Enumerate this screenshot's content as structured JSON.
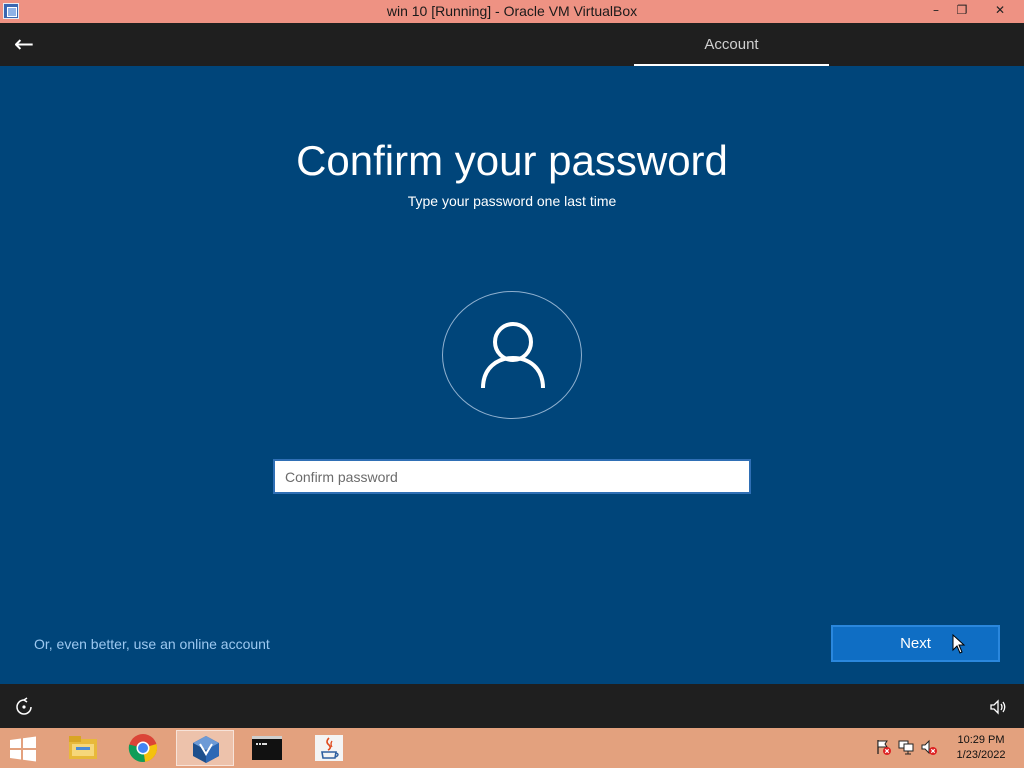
{
  "window": {
    "title": "win 10 [Running] - Oracle VM VirtualBox",
    "icon": "virtualbox-window-icon",
    "controls": [
      "minimize-icon",
      "restore-icon",
      "close-icon"
    ]
  },
  "oobe": {
    "back_icon": "back-arrow-icon",
    "nav_tab": "Account",
    "heading": "Confirm your password",
    "subheading": "Type your password one last time",
    "avatar_icon": "user-icon",
    "password_field": {
      "placeholder": "Confirm password",
      "value": ""
    },
    "online_account_link": "Or, even better, use an online account",
    "next_button": "Next",
    "bottom_left_icon": "ease-of-access-icon",
    "bottom_right_icon": "volume-icon"
  },
  "taskbar": {
    "start_icon": "windows-start-icon",
    "pinned": [
      {
        "name": "file-explorer-icon",
        "active": false
      },
      {
        "name": "chrome-icon",
        "active": false
      },
      {
        "name": "virtualbox-icon",
        "active": true
      },
      {
        "name": "command-prompt-icon",
        "active": false
      },
      {
        "name": "java-icon",
        "active": false
      }
    ],
    "tray_icons": [
      "action-center-flag-icon",
      "network-icon",
      "volume-muted-icon"
    ],
    "clock": {
      "time": "10:29 PM",
      "date": "1/23/2022"
    }
  },
  "colors": {
    "oobe_background": "#00457a",
    "oobe_bars": "#1f1f1f",
    "accent_button": "#0f6ec4",
    "link": "#9cc8f0",
    "titlebar": "#ee9283",
    "taskbar": "#e3a17e"
  }
}
